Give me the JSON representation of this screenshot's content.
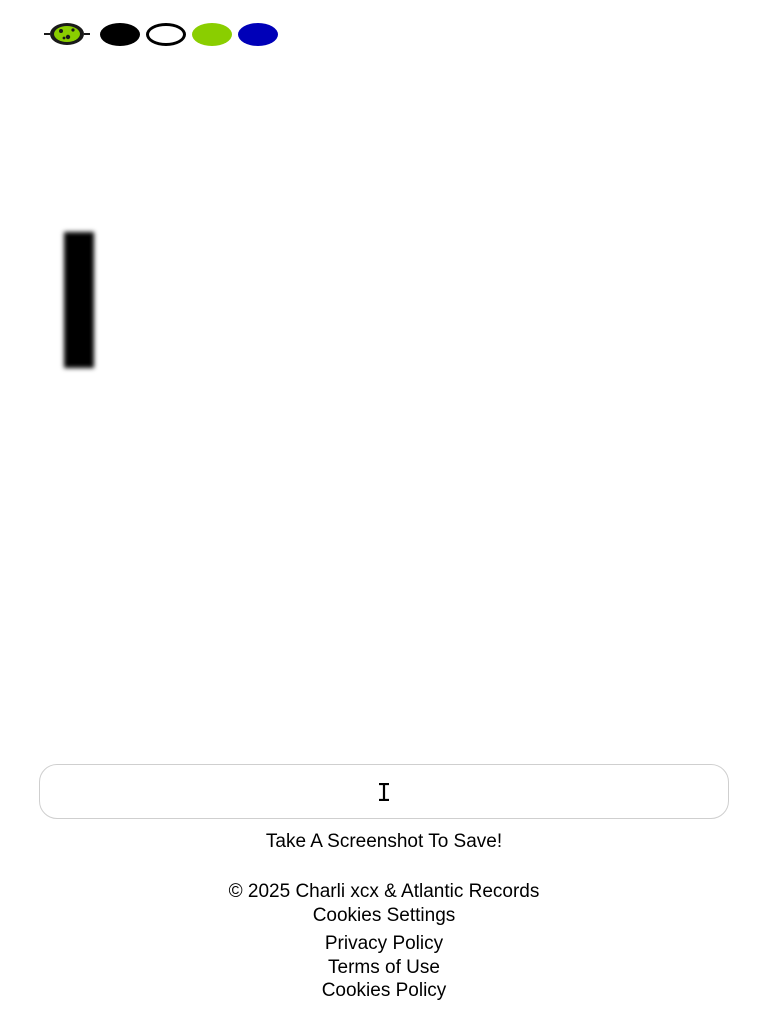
{
  "toolbar": {
    "logo_icon": "brat-logo-icon",
    "swatches": [
      {
        "name": "black",
        "color": "#000000",
        "style": "filled"
      },
      {
        "name": "white",
        "color": "#ffffff",
        "style": "outline"
      },
      {
        "name": "lime",
        "color": "#8ace00",
        "style": "filled"
      },
      {
        "name": "blue",
        "color": "#0000b8",
        "style": "filled"
      }
    ]
  },
  "canvas": {
    "cursor_icon": "text-cursor-icon"
  },
  "input": {
    "value": "",
    "cursor_icon": "ibeam-cursor-icon"
  },
  "caption": "Take A Screenshot To Save!",
  "footer": {
    "copyright": "© 2025 Charli xcx & Atlantic Records",
    "cookies_settings": "Cookies Settings",
    "links": {
      "privacy": "Privacy Policy",
      "terms": "Terms of Use",
      "cookies": "Cookies Policy"
    }
  }
}
